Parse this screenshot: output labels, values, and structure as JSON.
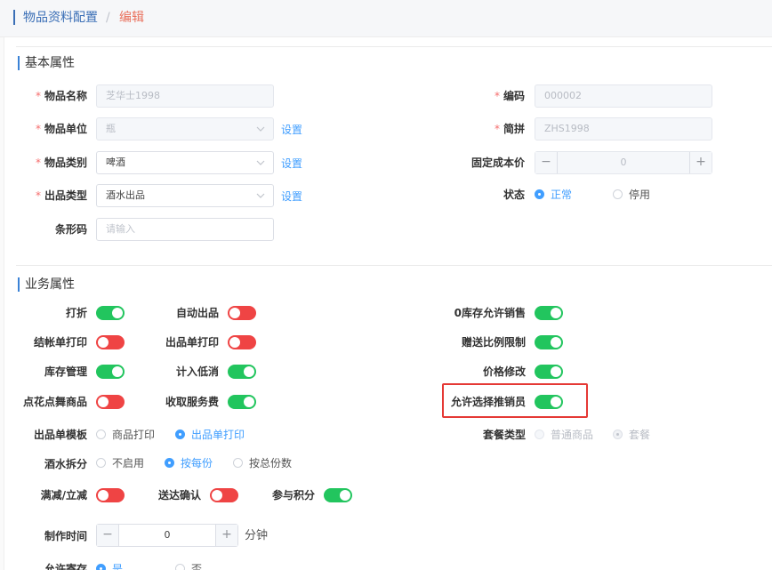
{
  "breadcrumb": {
    "parent": "物品资料配置",
    "separator": "/",
    "current": "编辑"
  },
  "basic": {
    "title": "基本属性",
    "required_mark": "*",
    "name": {
      "label": "物品名称",
      "value": "芝华士1998"
    },
    "unit": {
      "label": "物品单位",
      "value": "瓶",
      "link": "设置"
    },
    "category": {
      "label": "物品类别",
      "value": "啤酒",
      "link": "设置"
    },
    "out_type": {
      "label": "出品类型",
      "value": "酒水出品",
      "link": "设置"
    },
    "barcode": {
      "label": "条形码",
      "placeholder": "请输入"
    },
    "code": {
      "label": "编码",
      "value": "000002"
    },
    "pinyin": {
      "label": "简拼",
      "value": "ZHS1998"
    },
    "fixed_cost": {
      "label": "固定成本价",
      "value": "0",
      "minus": "−",
      "plus": "+"
    },
    "status": {
      "label": "状态",
      "options": [
        "正常",
        "停用"
      ],
      "selected": "正常"
    }
  },
  "business": {
    "title": "业务属性",
    "toggles": [
      {
        "label": "打折",
        "on": true
      },
      {
        "label": "自动出品",
        "on": false
      },
      {
        "label": "0库存允许销售",
        "on": true
      },
      {
        "label": "结帐单打印",
        "on": false
      },
      {
        "label": "出品单打印",
        "on": false
      },
      {
        "label": "赠送比例限制",
        "on": true
      },
      {
        "label": "库存管理",
        "on": true
      },
      {
        "label": "计入低消",
        "on": true
      },
      {
        "label": "价格修改",
        "on": true
      },
      {
        "label": "点花点舞商品",
        "on": false
      },
      {
        "label": "收取服务费",
        "on": true
      },
      {
        "label": "允许选择推销员",
        "on": true
      },
      {
        "label": "满减/立减",
        "on": false
      },
      {
        "label": "送达确认",
        "on": false
      },
      {
        "label": "参与积分",
        "on": true
      }
    ],
    "template": {
      "label": "出品单模板",
      "options": [
        "商品打印",
        "出品单打印"
      ],
      "selected": "出品单打印"
    },
    "package_type": {
      "label": "套餐类型",
      "options": [
        "普通商品",
        "套餐"
      ],
      "selected": "套餐"
    },
    "split": {
      "label": "酒水拆分",
      "options": [
        "不启用",
        "按每份",
        "按总份数"
      ],
      "selected": "按每份"
    },
    "make_time": {
      "label": "制作时间",
      "value": "0",
      "unit": "分钟",
      "minus": "−",
      "plus": "+"
    },
    "allow_stock": {
      "label": "允许寄存",
      "options": [
        "是",
        "否"
      ],
      "selected": "是"
    }
  },
  "colors": {
    "accent": "#409eff",
    "switch_on": "#22c55e",
    "switch_off": "#ef4444",
    "highlight": "#e53935",
    "required": "#f56c6c"
  }
}
